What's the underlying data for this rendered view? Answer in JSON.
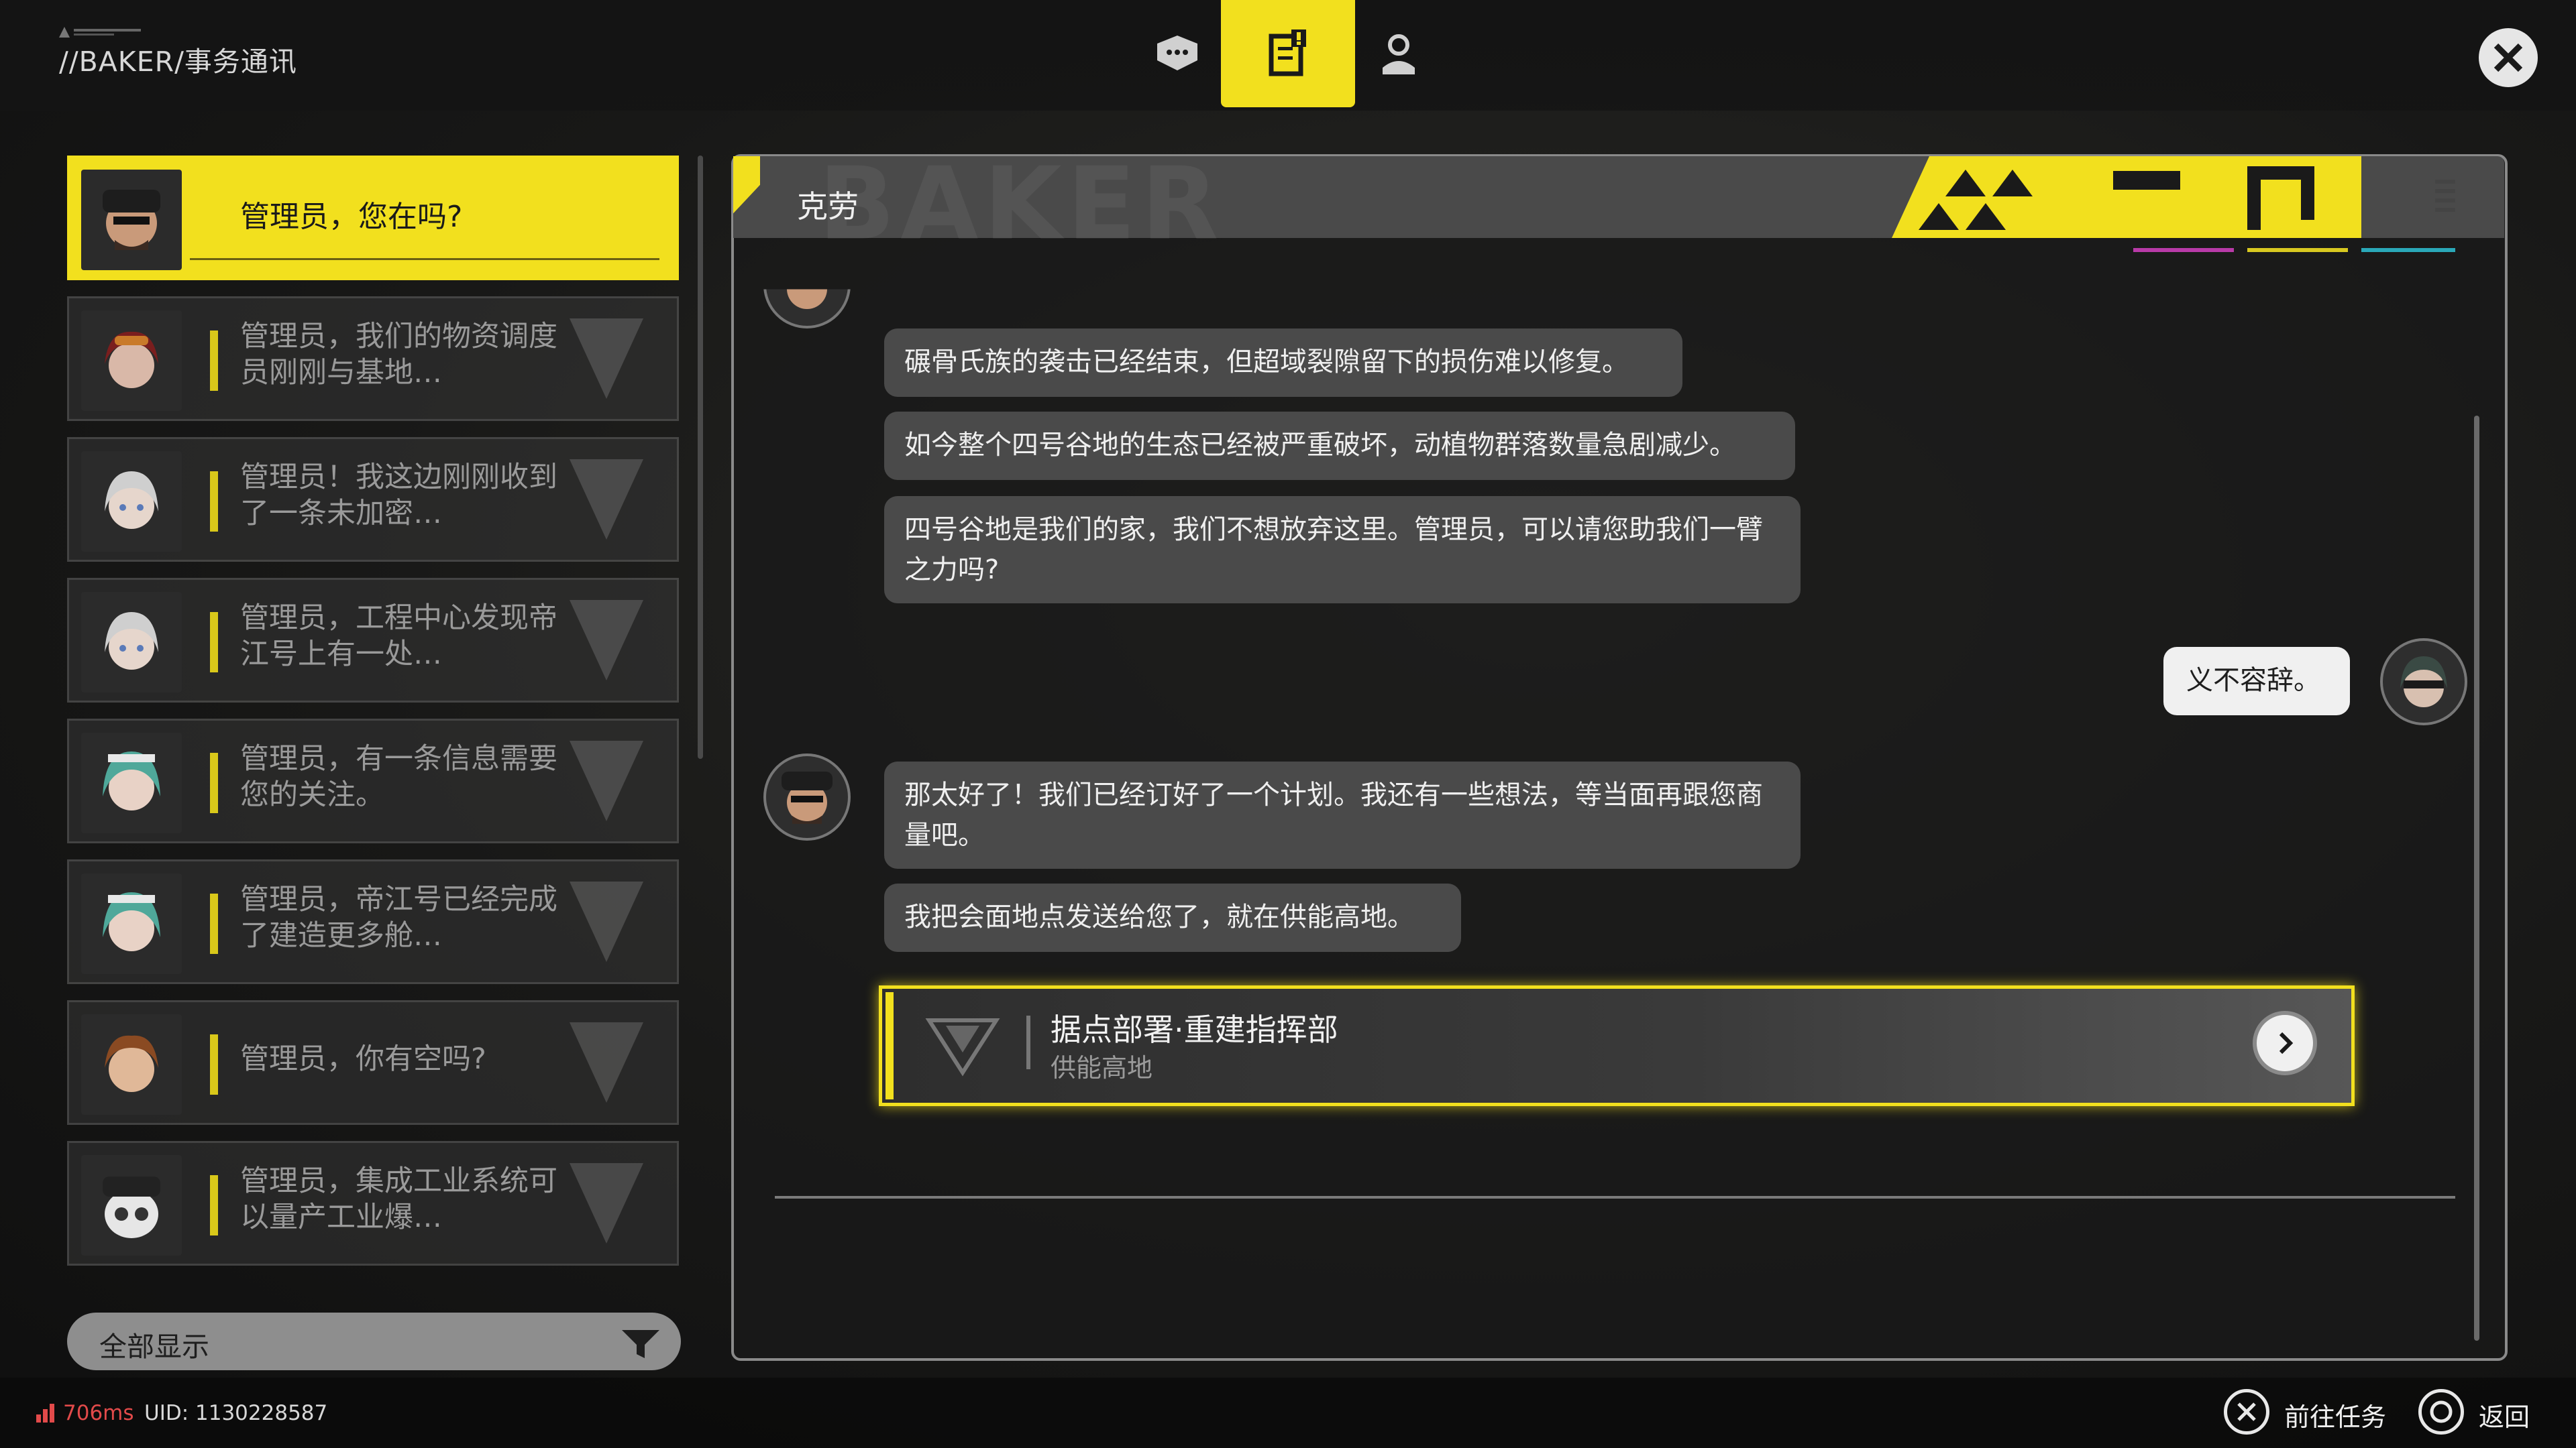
{
  "header": {
    "breadcrumb": "//BAKER/事务通讯"
  },
  "top_tabs": [
    {
      "name": "chat",
      "icon": "chat-bubbles-icon",
      "active": false
    },
    {
      "name": "missions",
      "icon": "task-board-icon",
      "active": true
    },
    {
      "name": "contacts",
      "icon": "person-icon",
      "active": false
    }
  ],
  "contacts": [
    {
      "preview": "管理员，您在吗?",
      "active": true
    },
    {
      "preview": "管理员，我们的物资调度员刚刚与基地…",
      "active": false
    },
    {
      "preview": "管理员！我这边刚刚收到了一条未加密…",
      "active": false
    },
    {
      "preview": "管理员，工程中心发现帝江号上有一处…",
      "active": false
    },
    {
      "preview": "管理员，有一条信息需要您的关注。",
      "active": false
    },
    {
      "preview": "管理员，帝江号已经完成了建造更多舱…",
      "active": false
    },
    {
      "preview": "管理员，你有空吗?",
      "active": false
    },
    {
      "preview": "管理员，集成工业系统可以量产工业爆…",
      "active": false
    }
  ],
  "filter": {
    "label": "全部显示"
  },
  "chat": {
    "contact_name": "克劳",
    "watermark": "BAKER",
    "messages": [
      {
        "from": "them",
        "text": "碾骨氏族的袭击已经结束，但超域裂隙留下的损伤难以修复。"
      },
      {
        "from": "them",
        "text": "如今整个四号谷地的生态已经被严重破坏，动植物群落数量急剧减少。"
      },
      {
        "from": "them",
        "text": "四号谷地是我们的家，我们不想放弃这里。管理员，可以请您助我们一臂之力吗?"
      },
      {
        "from": "me",
        "text": "义不容辞。"
      },
      {
        "from": "them",
        "text": "那太好了！我们已经订好了一个计划。我还有一些想法，等当面再跟您商量吧。"
      },
      {
        "from": "them",
        "text": "我把会面地点发送给您了，就在供能高地。"
      }
    ],
    "mission": {
      "title": "据点部署·重建指挥部",
      "location": "供能高地"
    }
  },
  "footer": {
    "ping": "706ms",
    "uid": "UID: 1130228587",
    "hints": [
      {
        "button": "cross",
        "label": "前往任务"
      },
      {
        "button": "circle",
        "label": "返回"
      }
    ]
  },
  "colors": {
    "accent": "#f2e01e",
    "panel": "#4a4a4a",
    "ping": "#e24a4a"
  }
}
